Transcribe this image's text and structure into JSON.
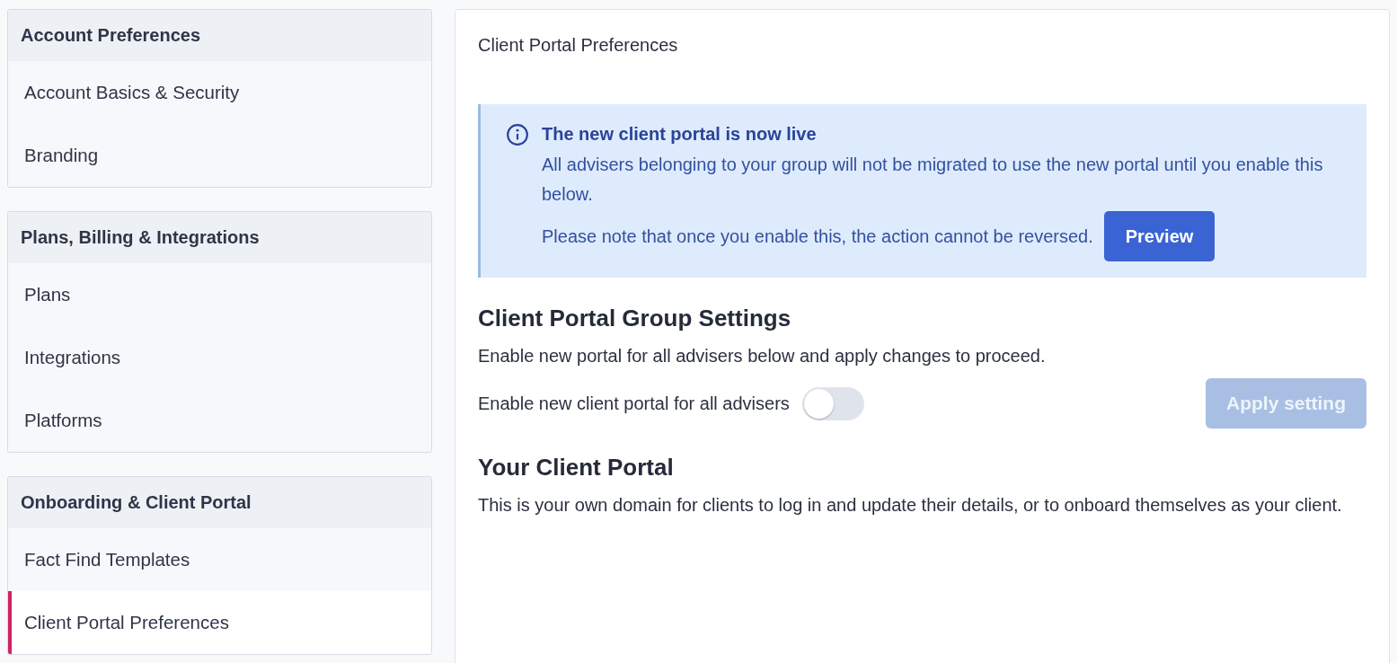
{
  "sidebar": {
    "groups": [
      {
        "title": "Account Preferences",
        "items": [
          {
            "label": "Account Basics & Security",
            "selected": false
          },
          {
            "label": "Branding",
            "selected": false
          }
        ]
      },
      {
        "title": "Plans, Billing & Integrations",
        "items": [
          {
            "label": "Plans",
            "selected": false
          },
          {
            "label": "Integrations",
            "selected": false
          },
          {
            "label": "Platforms",
            "selected": false
          }
        ]
      },
      {
        "title": "Onboarding & Client Portal",
        "items": [
          {
            "label": "Fact Find Templates",
            "selected": false
          },
          {
            "label": "Client Portal Preferences",
            "selected": true
          }
        ]
      }
    ]
  },
  "main": {
    "title": "Client Portal Preferences",
    "notice": {
      "title": "The new client portal is now live",
      "body": "All advisers belonging to your group will not be migrated to use the new portal until you enable this below.",
      "note": "Please note that once you enable this, the action cannot be reversed.",
      "button": "Preview"
    },
    "group_settings": {
      "heading": "Client Portal Group Settings",
      "description": "Enable new portal for all advisers below and apply changes to proceed.",
      "toggle": {
        "label": "Enable new client portal for all advisers",
        "on": false
      },
      "apply_button": {
        "label": "Apply setting",
        "disabled": true
      }
    },
    "portal": {
      "heading": "Your Client Portal",
      "description": "This is your own domain for clients to log in and update their details, or to onboard themselves as your client."
    }
  }
}
